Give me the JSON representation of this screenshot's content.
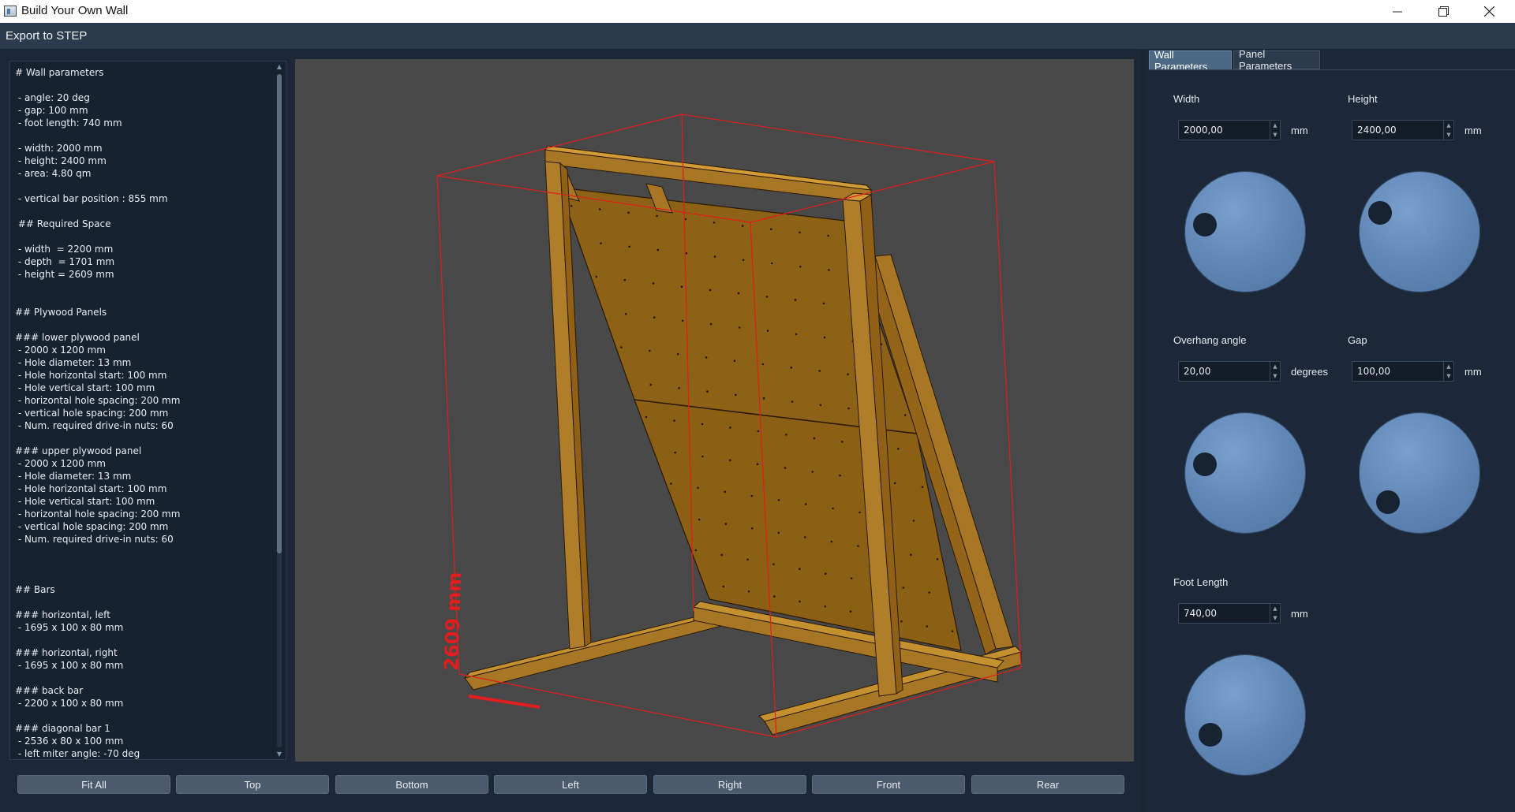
{
  "window": {
    "title": "Build Your Own Wall",
    "minimize_icon": "minimize-icon",
    "maximize_icon": "restore-icon",
    "close_icon": "close-icon"
  },
  "menubar": {
    "export": "Export to STEP"
  },
  "info": {
    "lines": [
      "# Wall parameters",
      "",
      " - angle: 20 deg",
      " - gap: 100 mm",
      " - foot length: 740 mm",
      "",
      " - width: 2000 mm",
      " - height: 2400 mm",
      " - area: 4.80 qm",
      "",
      " - vertical bar position : 855 mm",
      "",
      " ## Required Space",
      "",
      " - width  = 2200 mm",
      " - depth  = 1701 mm",
      " - height = 2609 mm",
      "",
      "",
      "## Plywood Panels",
      "",
      "### lower plywood panel",
      " - 2000 x 1200 mm",
      " - Hole diameter: 13 mm",
      " - Hole horizontal start: 100 mm",
      " - Hole vertical start: 100 mm",
      " - horizontal hole spacing: 200 mm",
      " - vertical hole spacing: 200 mm",
      " - Num. required drive-in nuts: 60",
      "",
      "### upper plywood panel",
      " - 2000 x 1200 mm",
      " - Hole diameter: 13 mm",
      " - Hole horizontal start: 100 mm",
      " - Hole vertical start: 100 mm",
      " - horizontal hole spacing: 200 mm",
      " - vertical hole spacing: 200 mm",
      " - Num. required drive-in nuts: 60",
      "",
      "",
      "",
      "## Bars",
      "",
      "### horizontal, left",
      " - 1695 x 100 x 80 mm",
      "",
      "### horizontal, right",
      " - 1695 x 100 x 80 mm",
      "",
      "### back bar",
      " - 2200 x 100 x 80 mm",
      "",
      "### diagonal bar 1",
      " - 2536 x 80 x 100 mm",
      " - left miter angle: -70 deg"
    ]
  },
  "viewport": {
    "dimension_label": "2609 mm"
  },
  "view_buttons": [
    "Fit All",
    "Top",
    "Bottom",
    "Left",
    "Right",
    "Front",
    "Rear"
  ],
  "tabs": {
    "wall": "Wall Parameters",
    "panel": "Panel Parameters"
  },
  "params": {
    "width": {
      "label": "Width",
      "value": "2000,00",
      "unit": "mm"
    },
    "height": {
      "label": "Height",
      "value": "2400,00",
      "unit": "mm"
    },
    "angle": {
      "label": "Overhang angle",
      "value": "20,00",
      "unit": "degrees"
    },
    "gap": {
      "label": "Gap",
      "value": "100,00",
      "unit": "mm"
    },
    "foot": {
      "label": "Foot Length",
      "value": "740,00",
      "unit": "mm"
    }
  },
  "colors": {
    "background": "#1c2838",
    "viewport": "#494949",
    "wood": "#9a6b1a",
    "panel": "#8b5f14",
    "bounding_box": "#e11d1d",
    "dial": "#6389b8"
  }
}
